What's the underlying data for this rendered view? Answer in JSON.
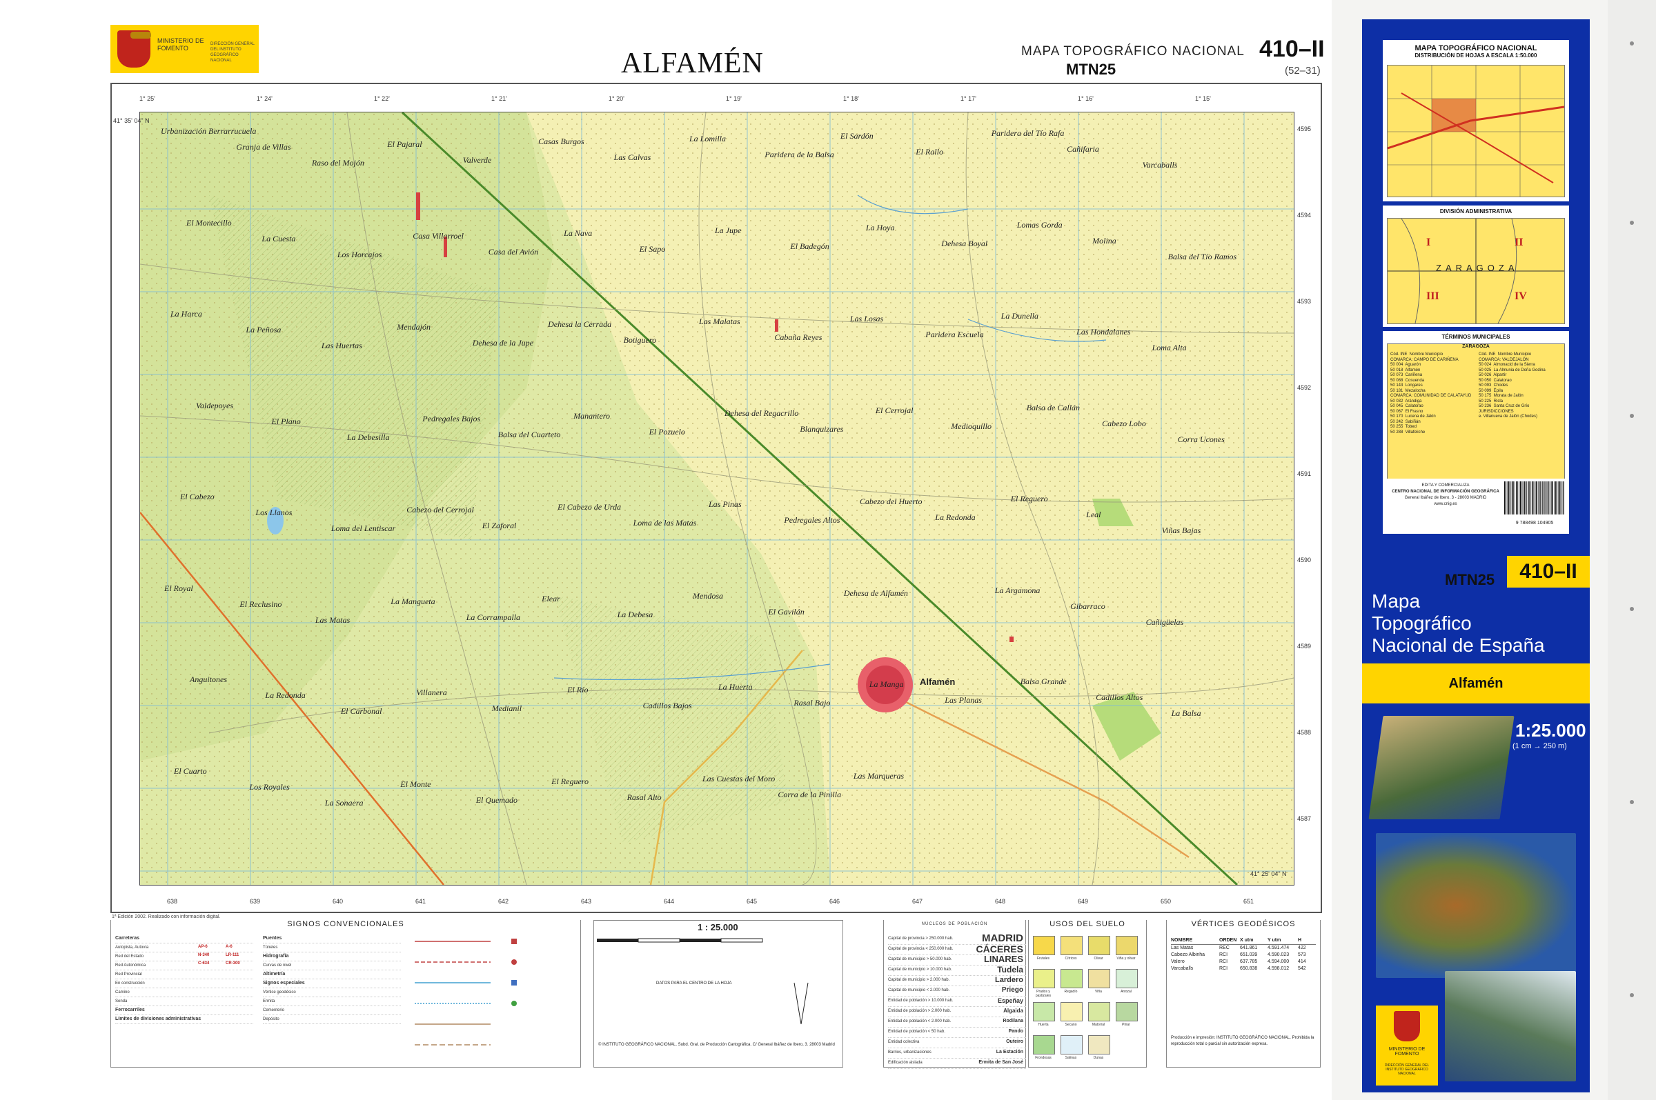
{
  "header": {
    "ministry": "MINISTERIO DE FOMENTO",
    "ministry_sub": "DIRECCIÓN GENERAL DEL INSTITUTO GEOGRÁFICO NACIONAL",
    "title": "ALFAMÉN",
    "series_line1": "MAPA TOPOGRÁFICO NACIONAL",
    "series_line2": "MTN25",
    "sheet_number": "410–II",
    "sheet_grid": "(52–31)"
  },
  "map": {
    "place_names": [
      "Urbanización Berrarrucuela",
      "Granja de Villas",
      "Raso del Mojón",
      "El Pajaral",
      "Valverde",
      "Casas Burgos",
      "Las Calvas",
      "La Lomilla",
      "Paridera de la Balsa",
      "El Sardón",
      "El Rallo",
      "Paridera del Tío Rafa",
      "Cañifaria",
      "Varcaballs",
      "El Montecillo",
      "La Cuesta",
      "Los Horcajos",
      "Casa Villarroel",
      "Casa del Avión",
      "La Nava",
      "El Sapo",
      "La Jupe",
      "El Badegón",
      "La Hoya",
      "Dehesa Boyal",
      "Lomas Gorda",
      "Molina",
      "Balsa del Tío Ramos",
      "La Harca",
      "La Peñosa",
      "Las Huertas",
      "Mendajón",
      "Dehesa de la Jupe",
      "Dehesa la Cerrada",
      "Botiguero",
      "Las Malatas",
      "Cabaña Reyes",
      "Las Losas",
      "Paridera Escuela",
      "La Dunella",
      "Las Hondalanes",
      "Loma Alta",
      "Valdepoyes",
      "El Plano",
      "La Debesilla",
      "Pedregales Bajos",
      "Balsa del Cuarteto",
      "Manantero",
      "El Pozuelo",
      "Dehesa del Regacrillo",
      "Blanquizares",
      "El Cerrojal",
      "Medioquillo",
      "Balsa de Callán",
      "Cabezo Lobo",
      "Corra Ucones",
      "El Cabezo",
      "Los Llanos",
      "Loma del Lentiscar",
      "Cabezo del Cerrojal",
      "El Zaforal",
      "El Cabezo de Urda",
      "Loma de las Matas",
      "Las Pinas",
      "Pedregales Altos",
      "Cabezo del Huerto",
      "La Redonda",
      "El Reguero",
      "Leal",
      "Viñas Bajas",
      "El Royal",
      "El Reclusino",
      "Las Matas",
      "La Mangueta",
      "La Corrampalla",
      "Elear",
      "La Debesa",
      "Mendosa",
      "El Gavilán",
      "Dehesa de Alfamén",
      "Alfamén",
      "La Argamona",
      "Gibarraco",
      "Cañigüelas",
      "Anguitones",
      "La Redonda",
      "El Carbonal",
      "Villanera",
      "Medianil",
      "El Río",
      "Cadillos Bajos",
      "La Huerta",
      "Rasal Bajo",
      "La Manga",
      "Las Planas",
      "Balsa Grande",
      "Cadillos Altos",
      "La Balsa",
      "El Cuarto",
      "Los Royales",
      "La Sonaera",
      "El Monte",
      "El Quemado",
      "El Reguero",
      "Rasal Alto",
      "Las Cuestas del Moro",
      "Corra de la Pinilla",
      "Las Marqueras"
    ],
    "coord_labels": [
      "41° 35' 04\" N",
      "1° 25'",
      "1° 24'",
      "1° 22'",
      "1° 21'",
      "1° 20'",
      "1° 19'",
      "1° 18'",
      "1° 17'",
      "1° 16'",
      "1° 15'",
      "41° 25' 04\" N"
    ],
    "grid_numbers": [
      "638",
      "639",
      "640",
      "641",
      "642",
      "643",
      "644",
      "645",
      "646",
      "647",
      "648",
      "649",
      "650",
      "651",
      "4595",
      "4594",
      "4593",
      "4592",
      "4591",
      "4590",
      "4589",
      "4588",
      "4587"
    ],
    "edition_note": "1ª Edición 2002. Realizado con información digital."
  },
  "legend": {
    "signos_title": "SIGNOS CONVENCIONALES",
    "scale_title": "1 : 25.000",
    "nucleos_title": "NÚCLEOS DE POBLACIÓN",
    "usos_title": "USOS DEL SUELO",
    "vertices_title": "VÉRTICES GEODÉSICOS",
    "road_rows": [
      "Carreteras",
      "Autopista, Autovía",
      "Red del Estado",
      "Red Autonómica",
      "Red Provincial",
      "En construcción",
      "Camino",
      "Senda",
      "Ferrocarriles",
      "Límites de divisiones administrativas"
    ],
    "road_codes": [
      "AP-6",
      "A-6",
      "N-340",
      "LR-111",
      "C-634",
      "CR-300"
    ],
    "feature_rows": [
      "Puentes",
      "Túneles",
      "Hidrografía",
      "Curvas de nivel",
      "Altimetría",
      "Signos especiales",
      "Vértice geodésico",
      "Ermita",
      "Cementerio",
      "Depósito"
    ],
    "nucleos": [
      {
        "label": "Capital de provincia > 250.000 hab.",
        "name": "MADRID"
      },
      {
        "label": "Capital de provincia < 250.000 hab.",
        "name": "CÁCERES"
      },
      {
        "label": "Capital de municipio > 50.000 hab.",
        "name": "LINARES"
      },
      {
        "label": "Capital de municipio > 10.000 hab.",
        "name": "Tudela"
      },
      {
        "label": "Capital de municipio > 2.000 hab.",
        "name": "Lardero"
      },
      {
        "label": "Capital de municipio < 2.000 hab.",
        "name": "Priego"
      },
      {
        "label": "Entidad de población > 10.000 hab.",
        "name": "Espeñay"
      },
      {
        "label": "Entidad de población > 2.000 hab.",
        "name": "Algaida"
      },
      {
        "label": "Entidad de población < 2.000 hab.",
        "name": "Rodilana"
      },
      {
        "label": "Entidad de población < 50 hab.",
        "name": "Pando"
      },
      {
        "label": "Entidad colectiva",
        "name": "Outeiro"
      },
      {
        "label": "Barrios, urbanizaciones",
        "name": "La Estación"
      },
      {
        "label": "Edificación aislada",
        "name": "Ermita de San José"
      }
    ],
    "usos": [
      "Frutales",
      "Cítricos",
      "Olivar",
      "Viña y olivar",
      "Prados y pastizales",
      "Regadío",
      "Viña",
      "Arrozal",
      "Huerta",
      "Secano",
      "Matorral",
      "Pinar",
      "Frondosas",
      "Salinas",
      "Dunas"
    ],
    "vertices_header": [
      "NOMBRE",
      "ORDEN",
      "X utm",
      "Y utm",
      "H"
    ],
    "vertices": [
      [
        "Las Matas",
        "REC",
        "641.861",
        "4.591.474",
        "422"
      ],
      [
        "Cabezo Albinha",
        "RCI",
        "651.039",
        "4.590.023",
        "573"
      ],
      [
        "Valero",
        "RCI",
        "637.785",
        "4.594.000",
        "414"
      ],
      [
        "Varcaballs",
        "RCI",
        "650.838",
        "4.598.012",
        "542"
      ]
    ],
    "scale_note": "DATOS PARA EL CENTRO DE LA HOJA",
    "footer_note": "© INSTITUTO GEOGRÁFICO NACIONAL. Subd. Gral. de Producción Cartográfica. C/ General Ibáñez de Ibero, 3. 28003 Madrid",
    "copyright_note": "Producción e impresión: INSTITUTO GEOGRÁFICO NACIONAL. Prohibida la reproducción total o parcial sin autorización expresa."
  },
  "panel": {
    "card1_title": "MAPA TOPOGRÁFICO NACIONAL",
    "card1_sub": "DISTRIBUCIÓN DE HOJAS A ESCALA 1:50.000",
    "card2_title": "DIVISIÓN ADMINISTRATIVA",
    "admin_region": "ZARAGOZA",
    "quadrants": [
      "I",
      "II",
      "III",
      "IV"
    ],
    "card3_title": "TÉRMINOS MUNICIPALES",
    "muni_province": "ZARAGOZA",
    "muni_left": "Cód. INE  Nombre Municipio\nCOMARCA: CAMPO DE CARIÑENA\n50 004  Aguarón\n50 018  Alfamén\n50 073  Cariñena\n50 088  Cosuenda\n50 143  Longares\n50 181  Mezalocha\nCOMARCA: COMUNIDAD DE CALATAYUD\n50 032  Arándiga\n50 045  Calatorao\n50 067  El Frasno\n50 170  Lucena de Jalón\n50 242  Sabiñán\n50 255  Tobed\n50 288  Villafeliche",
    "muni_right": "Cód. INE  Nombre Municipio\nCOMARCA: VALDEJALÓN\n50 024  Almonacid de la Sierra\n50 025  La Almunia de Doña Godina\n50 026  Alpartir\n50 050  Calatorao\n50 093  Chodes\n50 099  Épila\n50 175  Morata de Jalón\n50 225  Ricla\n50 236  Santa Cruz de Grío\nJURISDICCIONES\ne. Villanueva de Jalón (Chodes)",
    "publisher_lines": [
      "EDITA Y COMERCIALIZA",
      "CENTRO NACIONAL DE INFORMACIÓN GEOGRÁFICA",
      "General Ibáñez de Ibero, 3 - 28003 MADRID",
      "www.cnig.es"
    ],
    "barcode_text": "9 788498 104905",
    "mtn_badge": "MTN25",
    "sheet_badge": "410–II",
    "big_title_1": "Mapa",
    "big_title_2": "Topográfico",
    "big_title_3": "Nacional de España",
    "place": "Alfamén",
    "scale": "1:25.000",
    "scale_equiv": "(1 cm → 250 m)",
    "ministry_bottom": "MINISTERIO DE FOMENTO",
    "ministry_bottom_sub": "DIRECCIÓN GENERAL DEL INSTITUTO GEOGRÁFICO NACIONAL"
  }
}
